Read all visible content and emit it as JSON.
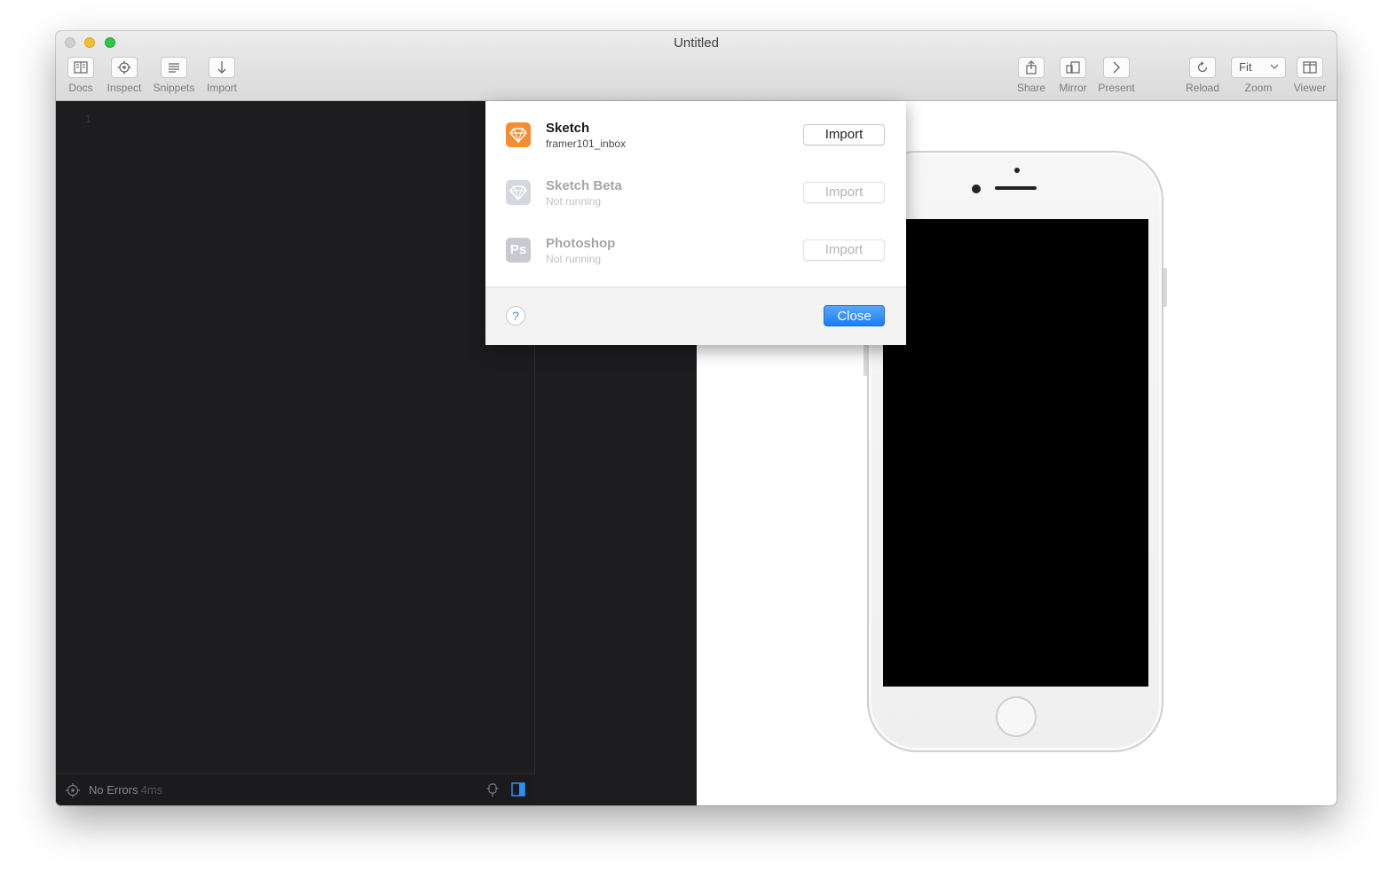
{
  "window": {
    "title": "Untitled"
  },
  "toolbar": {
    "left": [
      {
        "label": "Docs",
        "icon": "docs-icon"
      },
      {
        "label": "Inspect",
        "icon": "inspect-icon"
      },
      {
        "label": "Snippets",
        "icon": "snippets-icon"
      },
      {
        "label": "Import",
        "icon": "import-icon"
      }
    ],
    "right": [
      {
        "label": "Share",
        "icon": "share-icon"
      },
      {
        "label": "Mirror",
        "icon": "mirror-icon"
      },
      {
        "label": "Present",
        "icon": "present-icon"
      },
      {
        "label": "Reload",
        "icon": "reload-icon"
      },
      {
        "label": "Zoom",
        "value": "Fit"
      },
      {
        "label": "Viewer",
        "icon": "viewer-icon"
      }
    ]
  },
  "editor": {
    "line_number": "1",
    "status": {
      "text": "No Errors",
      "time": "4ms"
    }
  },
  "import_sheet": {
    "apps": [
      {
        "name": "Sketch",
        "subtitle": "framer101_inbox",
        "button": "Import",
        "enabled": true
      },
      {
        "name": "Sketch Beta",
        "subtitle": "Not running",
        "button": "Import",
        "enabled": false
      },
      {
        "name": "Photoshop",
        "subtitle": "Not running",
        "button": "Import",
        "enabled": false,
        "icon_text": "Ps"
      }
    ],
    "help_label": "?",
    "close_label": "Close"
  },
  "colors": {
    "accent": "#1a7df6",
    "sketch_orange": "#f48d32",
    "editor_bg": "#1d1d1f"
  }
}
